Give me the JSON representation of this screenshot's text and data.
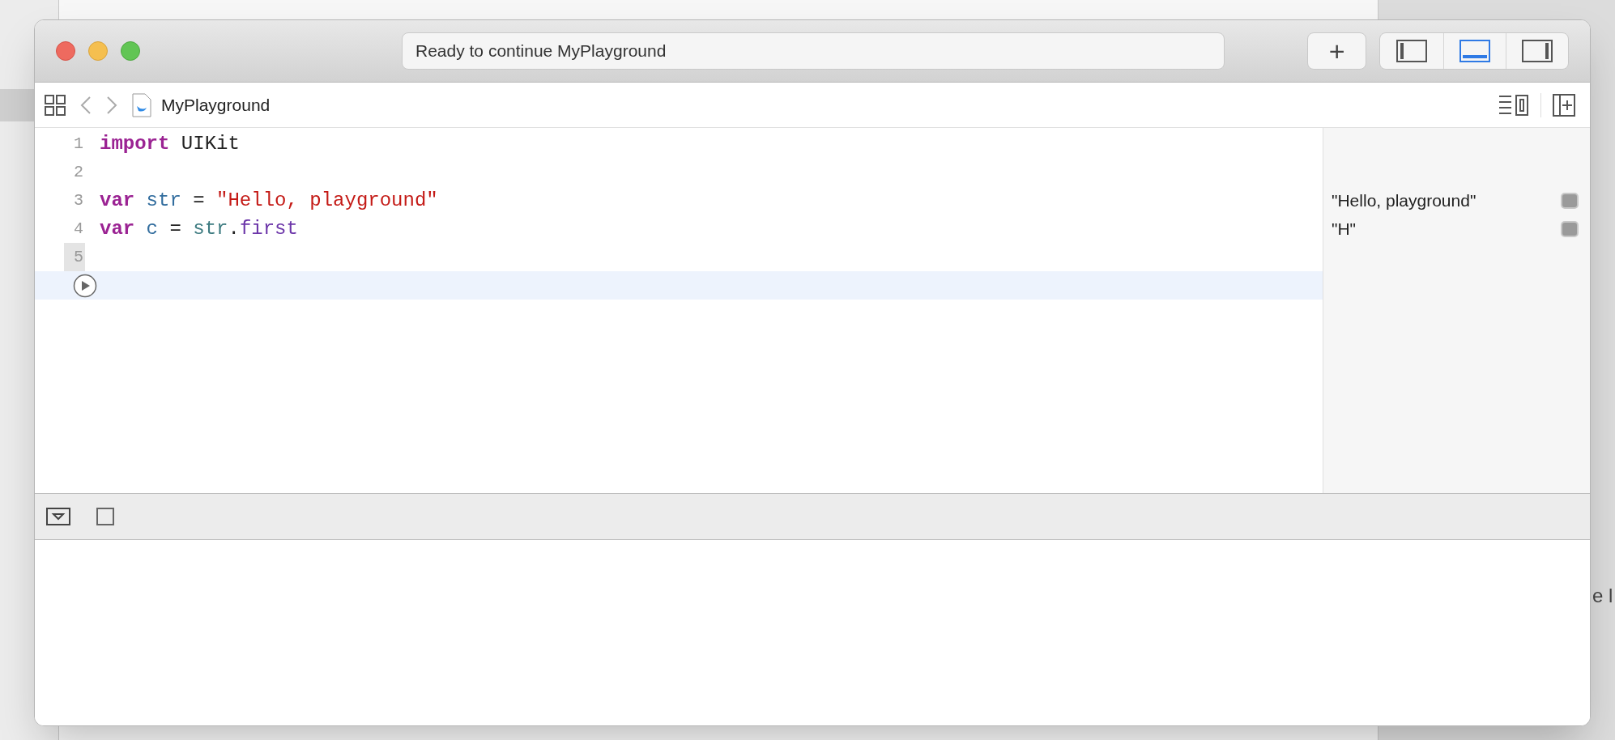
{
  "background": {
    "right_text": "e l"
  },
  "window": {
    "status": "Ready to continue MyPlayground",
    "add_button": "+",
    "panel_toggles": [
      {
        "kind": "left",
        "selected": false
      },
      {
        "kind": "bottom",
        "selected": true
      },
      {
        "kind": "right",
        "selected": false
      }
    ]
  },
  "jump_bar": {
    "file": "MyPlayground"
  },
  "editor": {
    "lines": [
      {
        "number": "1",
        "current": false,
        "tokens": [
          {
            "kind": "keyword",
            "text": "import"
          },
          {
            "kind": "plain",
            "text": " UIKit"
          }
        ]
      },
      {
        "number": "2",
        "current": false
      },
      {
        "number": "3",
        "current": false,
        "result": "\"Hello, playground\"",
        "tokens": [
          {
            "kind": "keyword",
            "text": "var"
          },
          {
            "kind": "ident",
            "text": " str"
          },
          {
            "kind": "plain",
            "text": " = "
          },
          {
            "kind": "string",
            "text": "\"Hello, playground\""
          }
        ]
      },
      {
        "number": "4",
        "current": false,
        "result": "\"H\"",
        "tokens": [
          {
            "kind": "keyword",
            "text": "var"
          },
          {
            "kind": "ident",
            "text": " c"
          },
          {
            "kind": "plain",
            "text": " = "
          },
          {
            "kind": "ref",
            "text": "str"
          },
          {
            "kind": "plain",
            "text": "."
          },
          {
            "kind": "property",
            "text": "first"
          }
        ]
      },
      {
        "number": "5",
        "current": true
      }
    ]
  }
}
